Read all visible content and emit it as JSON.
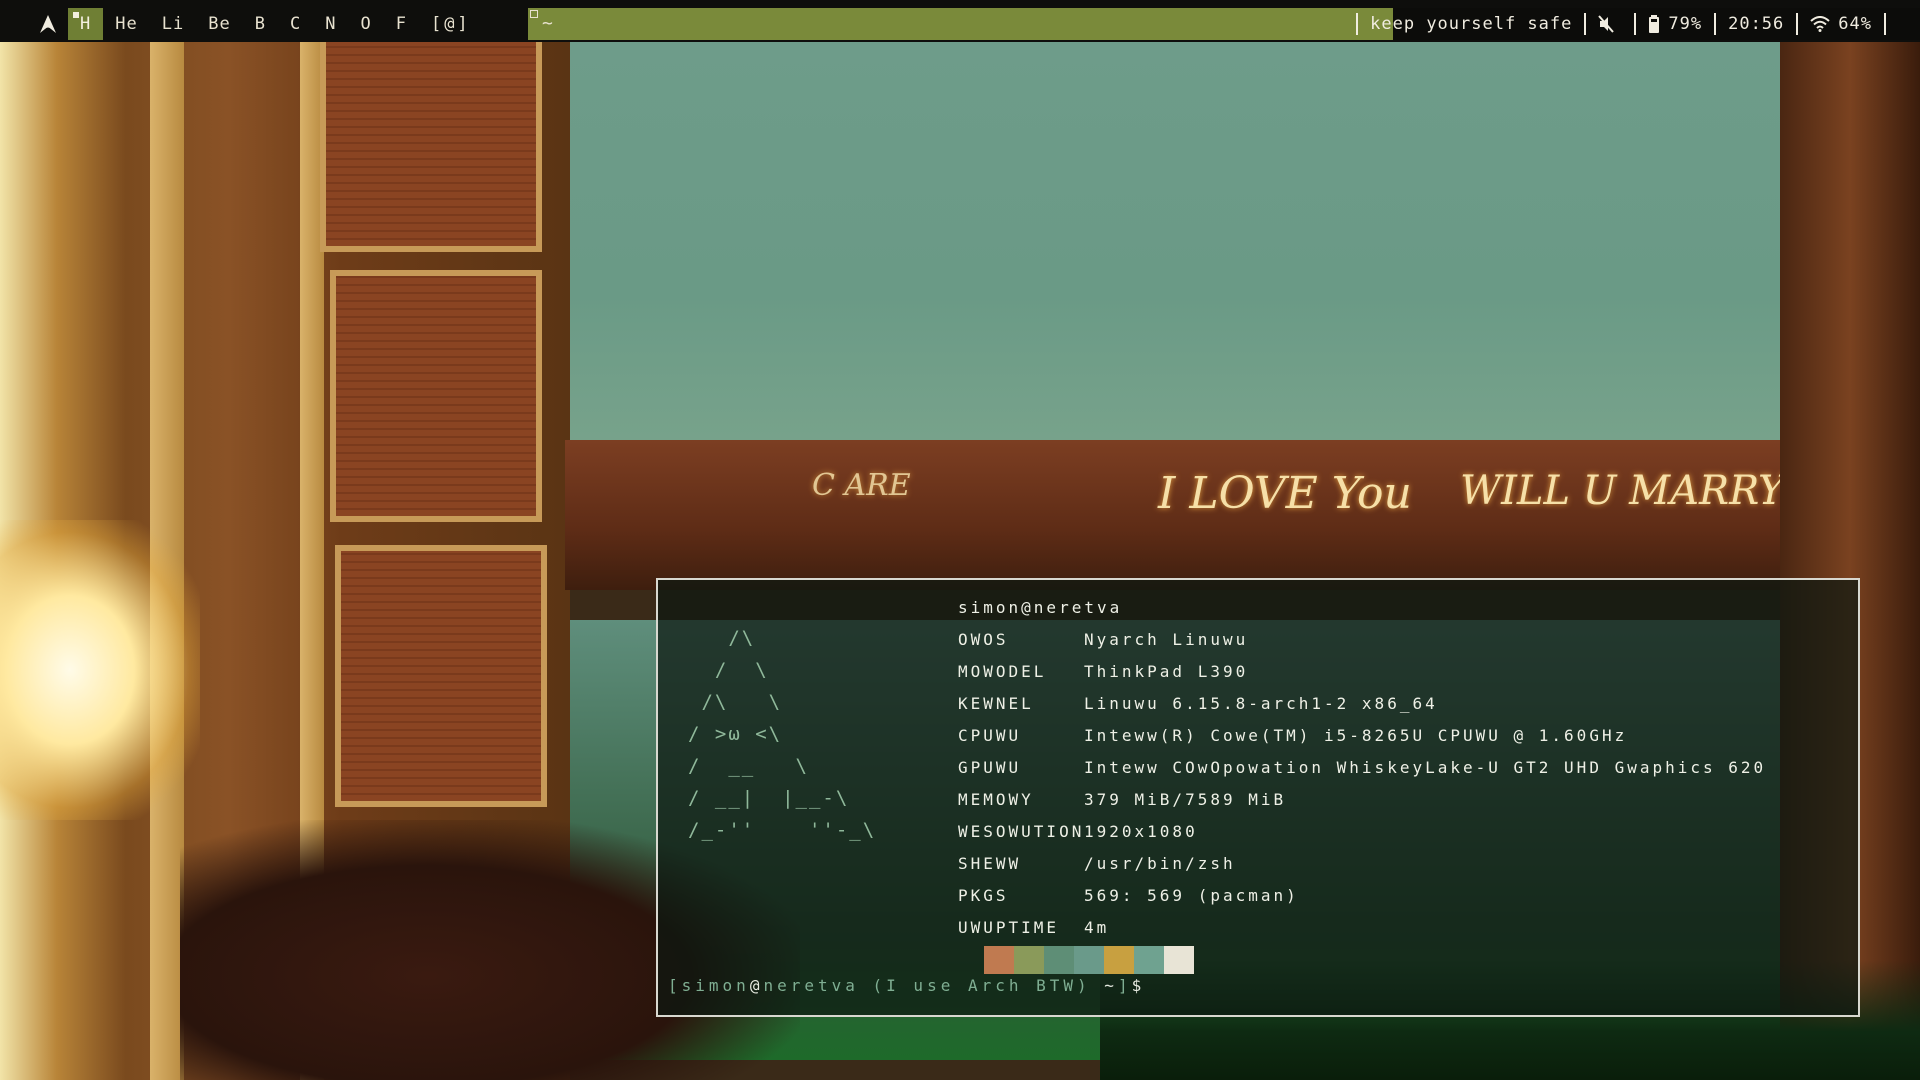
{
  "topbar": {
    "launcher_icon": "arch-logo-icon",
    "workspaces": [
      "H",
      "He",
      "Li",
      "Be",
      "B",
      "C",
      "N",
      "O",
      "F",
      "[@]"
    ],
    "active_workspace": 0,
    "window_title": "~",
    "status": {
      "message": "keep yourself safe",
      "mute_icon": "speaker-muted-icon",
      "battery_icon": "battery-icon",
      "battery": "79%",
      "clock": "20:56",
      "wifi_icon": "wifi-icon",
      "wifi": "64%"
    }
  },
  "terminal": {
    "ascii_logo": "   /\\\n  /  \\\n /\\   \\\n/ >ω <\\\n/  __   \\\n/ __|  |__-\\\n/_-''    ''-_\\",
    "hostname": "simon@neretva",
    "fields": [
      {
        "key": "OWOS",
        "value": "Nyarch Linuwu"
      },
      {
        "key": "MOWODEL",
        "value": "ThinkPad L390"
      },
      {
        "key": "KEWNEL",
        "value": "Linuwu 6.15.8-arch1-2 x86_64"
      },
      {
        "key": "CPUWU",
        "value": "Inteww(R) Cowe(TM) i5-8265U CPUWU @ 1.60GHz"
      },
      {
        "key": "GPUWU",
        "value": "Inteww COwOpowation WhiskeyLake-U GT2 UHD Gwaphics 620"
      },
      {
        "key": "MEMOWY",
        "value": "379 MiB/7589 MiB"
      },
      {
        "key": "WESOWUTION",
        "value": "1920x1080"
      },
      {
        "key": "SHEWW",
        "value": "/usr/bin/zsh"
      },
      {
        "key": "PKGS",
        "value": "569: 569 (pacman)"
      },
      {
        "key": "UWUPTIME",
        "value": "4m"
      }
    ],
    "palette": [
      "#c07a50",
      "#8a9a5a",
      "#5e8e76",
      "#6a9a8a",
      "#c8a040",
      "#6fa290",
      "#e8e4d6"
    ],
    "prompt": {
      "user": "simon",
      "at": "@",
      "host": "neretva",
      "note": "(I use Arch BTW)",
      "cwd": "~",
      "symbol": "$"
    }
  }
}
